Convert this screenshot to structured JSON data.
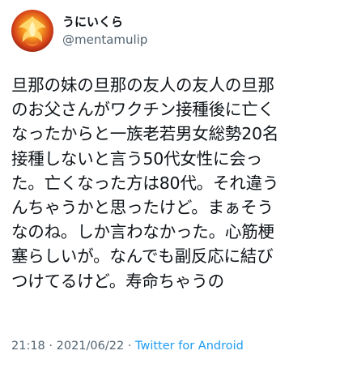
{
  "user": {
    "display_name": "うにいくら",
    "handle": "@mentamulip",
    "avatar_icon": "phoenix-avatar-icon"
  },
  "tweet": {
    "lines": [
      "旦那の妹の旦那の友人の友人の旦那",
      "のお父さんがワクチン接種後に亡く",
      "なったからと一族老若男女総勢20名",
      "接種しないと言う50代女性に会っ",
      "た。亡くなった方は80代。それ違う",
      "んちゃうかと思ったけど。まぁそう",
      "なのね。しか言わなかった。心筋梗",
      "塞らしいが。なんでも副反応に結び",
      "つけてるけど。寿命ちゃうの"
    ]
  },
  "meta": {
    "time": "21:18",
    "separator": "·",
    "date": "2021/06/22",
    "source": "Twitter for Android"
  },
  "colors": {
    "text": "#0f1419",
    "secondary": "#536471",
    "link": "#1d9bf0"
  }
}
